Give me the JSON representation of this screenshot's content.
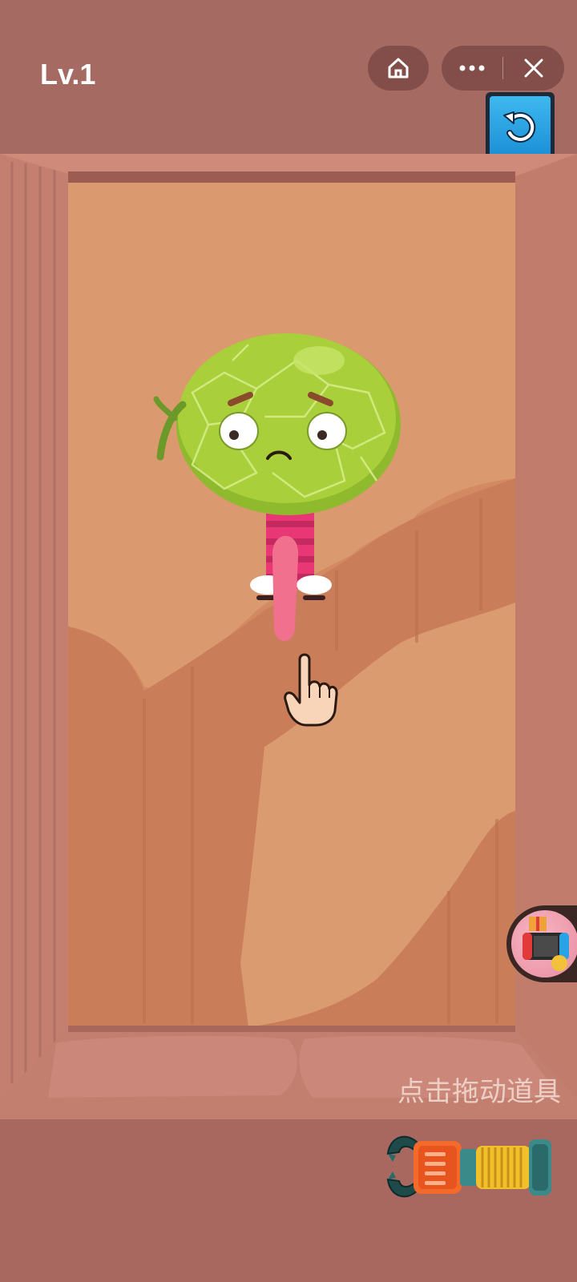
{
  "header": {
    "level_label": "Lv.1",
    "home_icon": "home-icon",
    "more_icon": "more-dots-icon",
    "close_icon": "close-icon",
    "undo_icon": "undo-icon"
  },
  "game": {
    "character": "melon-character",
    "hint_hand_icon": "pointing-hand-icon",
    "tool_icon": "grabber-claw-tool-icon",
    "gift_icon": "gift-console-icon",
    "hint_text": "点击拖动道具"
  },
  "colors": {
    "background": "#a8685f",
    "wood": "#d68c62",
    "melon": "#a9cf3a",
    "undo_button": "#2aa3e6",
    "tongue": "#f0708e",
    "shirt": "#e83774"
  }
}
